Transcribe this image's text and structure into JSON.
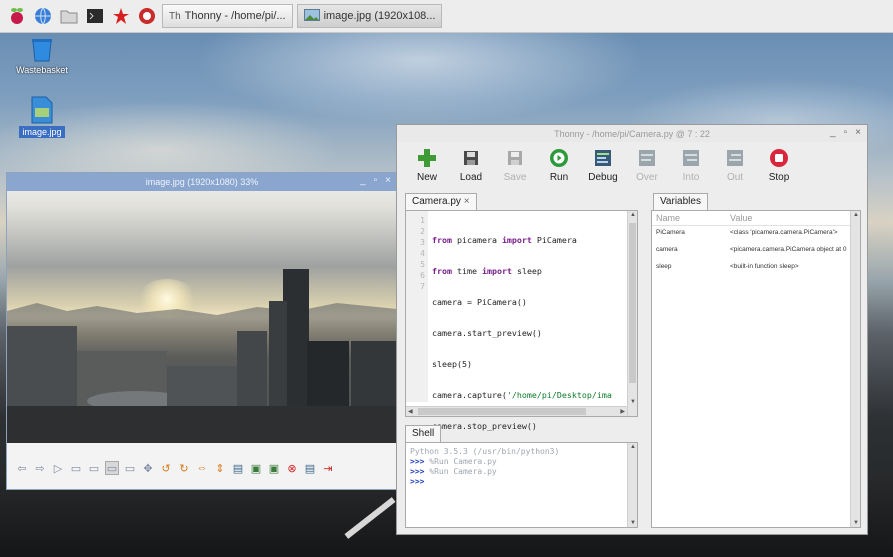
{
  "taskbar": {
    "launchers": [
      "raspberry-menu-icon",
      "web-browser-icon",
      "file-manager-icon",
      "terminal-icon",
      "mathematica-icon",
      "wolfram-icon"
    ],
    "tasks": [
      {
        "label": "Thonny  -  /home/pi/...",
        "icon": "thonny-app-icon"
      },
      {
        "label": "image.jpg (1920x108...",
        "icon": "image-viewer-app-icon"
      }
    ]
  },
  "desktop_icons": [
    {
      "label": "Wastebasket",
      "icon": "wastebasket-icon"
    },
    {
      "label": "image.jpg",
      "icon": "image-file-icon"
    }
  ],
  "viewer": {
    "title": "image.jpg (1920x1080) 33%",
    "controls": {
      "minimize": "_",
      "maximize": "▫",
      "close": "×"
    }
  },
  "thonny": {
    "title": "Thonny  -  /home/pi/Camera.py  @  7 : 22",
    "controls": {
      "minimize": "_",
      "maximize": "▫",
      "close": "×"
    },
    "toolbar": [
      {
        "label": "New",
        "icon": "new-file-icon",
        "enabled": true,
        "color": "#3f9b35"
      },
      {
        "label": "Load",
        "icon": "load-file-icon",
        "enabled": true,
        "color": "#3b3b3b"
      },
      {
        "label": "Save",
        "icon": "save-file-icon",
        "enabled": false,
        "color": "#9a9a9a"
      },
      {
        "label": "Run",
        "icon": "run-icon",
        "enabled": true,
        "color": "#2c9a3a"
      },
      {
        "label": "Debug",
        "icon": "debug-icon",
        "enabled": true,
        "color": "#365a78"
      },
      {
        "label": "Over",
        "icon": "step-over-icon",
        "enabled": false,
        "color": "#9aa6ac"
      },
      {
        "label": "Into",
        "icon": "step-into-icon",
        "enabled": false,
        "color": "#9aa6ac"
      },
      {
        "label": "Out",
        "icon": "step-out-icon",
        "enabled": false,
        "color": "#9aa6ac"
      },
      {
        "label": "Stop",
        "icon": "stop-icon",
        "enabled": true,
        "color": "#d9263c"
      }
    ],
    "editor": {
      "tab": "Camera.py",
      "tab_close": "×",
      "line_numbers": [
        "1",
        "2",
        "3",
        "4",
        "5",
        "6",
        "7"
      ],
      "lines": [
        [
          {
            "t": "from",
            "k": "kw"
          },
          {
            "t": " picamera ",
            "k": ""
          },
          {
            "t": "import",
            "k": "kw"
          },
          {
            "t": " PiCamera",
            "k": ""
          }
        ],
        [
          {
            "t": "from",
            "k": "kw"
          },
          {
            "t": " time ",
            "k": ""
          },
          {
            "t": "import",
            "k": "kw"
          },
          {
            "t": " sleep",
            "k": ""
          }
        ],
        [
          {
            "t": "camera = PiCamera()",
            "k": ""
          }
        ],
        [
          {
            "t": "camera.start_preview()",
            "k": ""
          }
        ],
        [
          {
            "t": "sleep(5)",
            "k": ""
          }
        ],
        [
          {
            "t": "camera.capture(",
            "k": ""
          },
          {
            "t": "'/home/pi/Desktop/ima",
            "k": "str"
          }
        ],
        [
          {
            "t": "camera.stop_preview()",
            "k": ""
          }
        ]
      ]
    },
    "variables": {
      "tab": "Variables",
      "headers": {
        "name": "Name",
        "value": "Value"
      },
      "rows": [
        {
          "name": "PiCamera",
          "value": "<class 'picamera.camera.PiCamera'>"
        },
        {
          "name": "camera",
          "value": "<picamera.camera.PiCamera object at 0"
        },
        {
          "name": "sleep",
          "value": "<built-in function sleep>"
        }
      ]
    },
    "shell": {
      "tab": "Shell",
      "banner": "Python 3.5.3 (/usr/bin/python3)",
      "history": [
        {
          "prompt": ">>>",
          "command": " %Run Camera.py"
        },
        {
          "prompt": ">>>",
          "command": " %Run Camera.py"
        }
      ],
      "current_prompt": ">>>"
    }
  }
}
